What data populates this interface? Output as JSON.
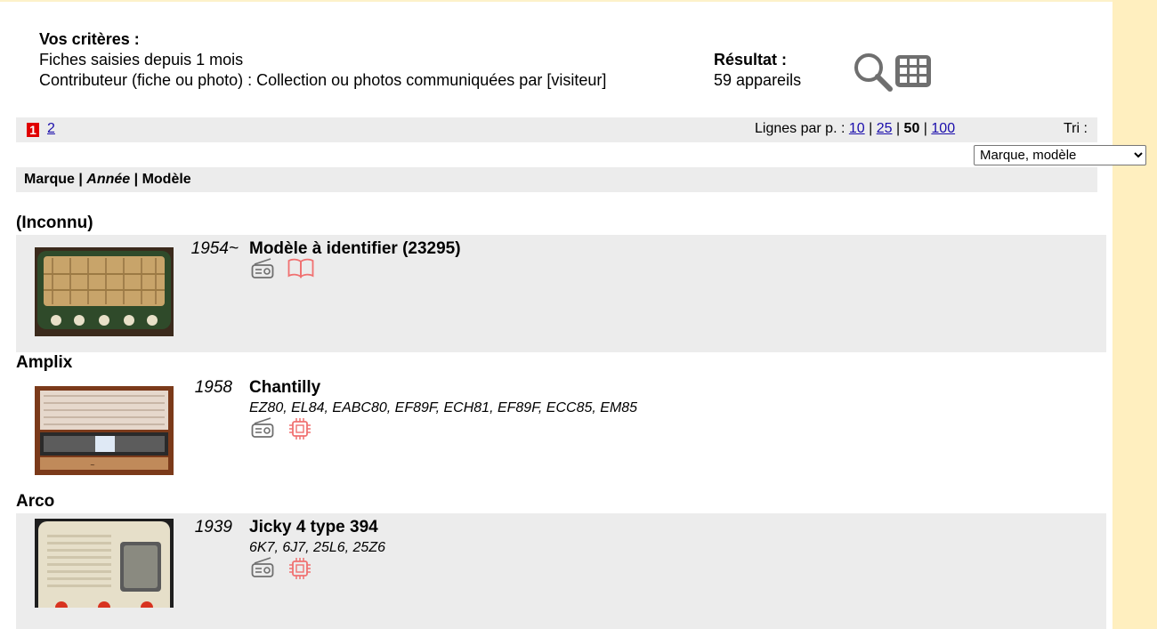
{
  "criteria": {
    "heading": "Vos critères :",
    "line1": "Fiches saisies depuis 1 mois",
    "line2": "Contributeur (fiche ou photo) : Collection ou photos communiquées par [visiteur]"
  },
  "result": {
    "heading": "Résultat :",
    "count": "59 appareils"
  },
  "view_icons": [
    "search-icon",
    "grid-view-icon"
  ],
  "pager": {
    "current": "1",
    "pages": [
      "2"
    ],
    "per_page_label": "Lignes par p. :",
    "per_page_options": [
      "10",
      "25",
      "50",
      "100"
    ],
    "per_page_selected": "50",
    "sort_label": "Tri :",
    "sort_selected": "Marque, modèle"
  },
  "columns": {
    "brand": "Marque",
    "sep1": " | ",
    "year": "Année",
    "sep2": " | ",
    "model": "Modèle"
  },
  "groups": [
    {
      "brand": "(Inconnu)",
      "year": "1954~",
      "model": "Modèle à identifier (23295)",
      "tubes": "",
      "icons": [
        "radio-icon",
        "book-icon"
      ]
    },
    {
      "brand": "Amplix",
      "year": "1958",
      "model": "Chantilly",
      "tubes": "EZ80, EL84, EABC80, EF89F, ECH81, EF89F, ECC85, EM85",
      "icons": [
        "radio-icon",
        "chip-icon"
      ]
    },
    {
      "brand": "Arco",
      "year": "1939",
      "model": "Jicky 4 type 394",
      "tubes": "6K7, 6J7, 25L6, 25Z6",
      "icons": [
        "radio-icon",
        "chip-icon"
      ]
    }
  ],
  "colors": {
    "side_band": "#ffefbf",
    "row_background": "#ececec",
    "page_current": "#e00000",
    "link": "#1a0dab",
    "icon_gray": "#6f6f6f",
    "icon_red": "#f07070"
  }
}
